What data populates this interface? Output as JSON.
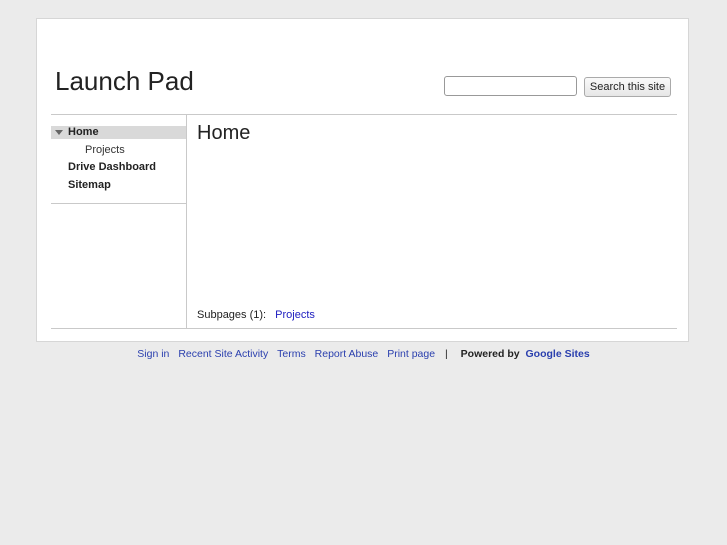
{
  "site": {
    "title": "Launch Pad"
  },
  "search": {
    "button_label": "Search this site",
    "value": ""
  },
  "sidebar": {
    "items": [
      {
        "label": "Home",
        "selected": true,
        "expanded": true
      },
      {
        "label": "Projects",
        "child": true
      },
      {
        "label": "Drive Dashboard"
      },
      {
        "label": "Sitemap"
      }
    ]
  },
  "main": {
    "heading": "Home",
    "subpages_label": "Subpages (1):",
    "subpages": [
      {
        "label": "Projects"
      }
    ]
  },
  "footer": {
    "links": [
      "Sign in",
      "Recent Site Activity",
      "Terms",
      "Report Abuse",
      "Print page"
    ],
    "separator": "|",
    "powered_by": "Powered by",
    "brand": "Google Sites"
  },
  "colors": {
    "background": "#ebebeb",
    "link": "#2a3fae",
    "selected_nav": "#d9d9d9"
  }
}
